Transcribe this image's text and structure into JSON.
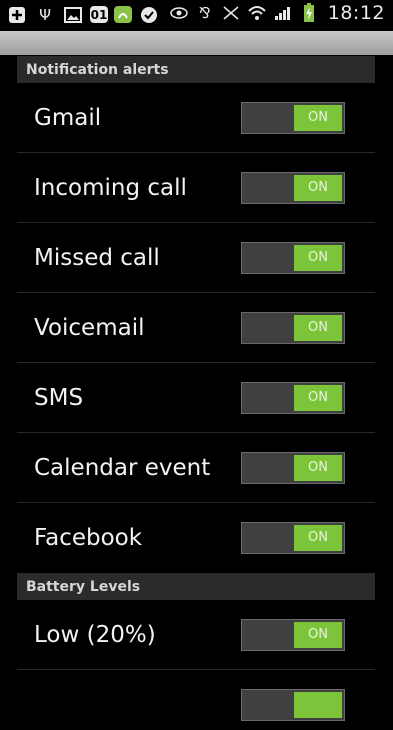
{
  "status_bar": {
    "time": "18:12",
    "icons": [
      "add-box-icon",
      "usb-icon",
      "image-icon",
      "calendar-icon",
      "app-icon",
      "check-icon",
      "eye-icon",
      "bluetooth-icon",
      "mute-icon",
      "wifi-icon",
      "signal-icon",
      "battery-charging-icon"
    ],
    "calendar_day": "01",
    "battery_color": "#8bc34a"
  },
  "sections": [
    {
      "title": "Notification alerts",
      "items": [
        {
          "label": "Gmail",
          "toggle": "ON"
        },
        {
          "label": "Incoming call",
          "toggle": "ON"
        },
        {
          "label": "Missed call",
          "toggle": "ON"
        },
        {
          "label": "Voicemail",
          "toggle": "ON"
        },
        {
          "label": "SMS",
          "toggle": "ON"
        },
        {
          "label": "Calendar event",
          "toggle": "ON"
        },
        {
          "label": "Facebook",
          "toggle": "ON"
        }
      ]
    },
    {
      "title": "Battery Levels",
      "items": [
        {
          "label": "Low (20%)",
          "toggle": "ON"
        },
        {
          "label": "",
          "toggle": ""
        }
      ]
    }
  ],
  "colors": {
    "toggle_on": "#7cc43a",
    "background": "#000000",
    "section_header": "#2b2b2b"
  }
}
